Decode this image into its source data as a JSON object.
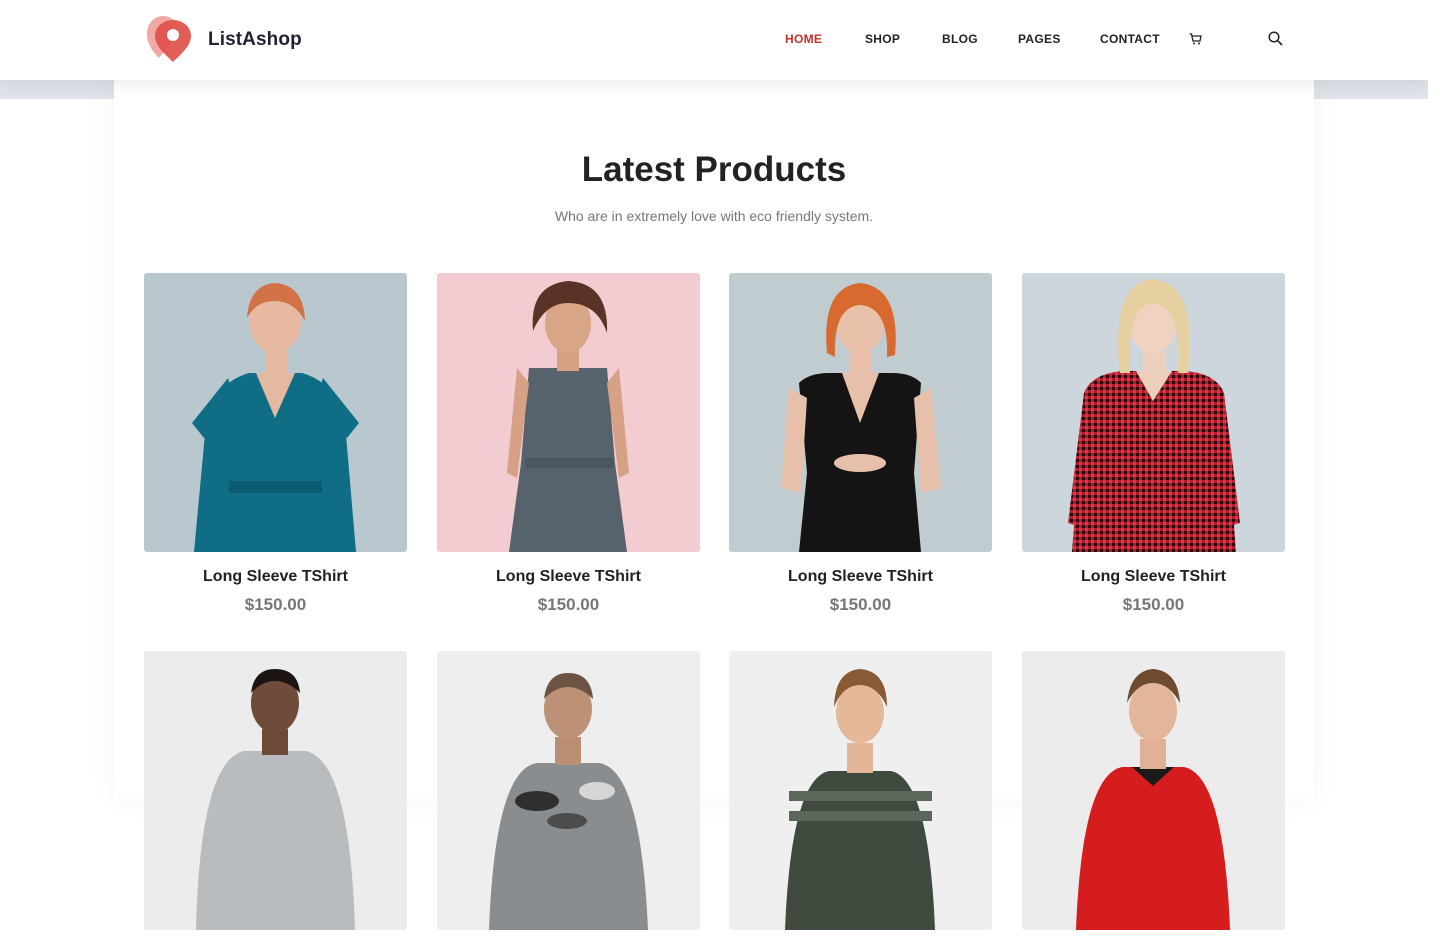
{
  "brand": {
    "name": "ListAshop"
  },
  "nav": {
    "items": [
      {
        "label": "HOME",
        "active": true
      },
      {
        "label": "SHOP",
        "active": false
      },
      {
        "label": "BLOG",
        "active": false
      },
      {
        "label": "PAGES",
        "active": false
      },
      {
        "label": "CONTACT",
        "active": false
      }
    ],
    "icons": [
      "cart-icon",
      "search-icon"
    ]
  },
  "section": {
    "title": "Latest Products",
    "subtitle": "Who are in extremely love with eco friendly system."
  },
  "products": [
    {
      "name": "Long Sleeve TShirt",
      "price": "$150.00"
    },
    {
      "name": "Long Sleeve TShirt",
      "price": "$150.00"
    },
    {
      "name": "Long Sleeve TShirt",
      "price": "$150.00"
    },
    {
      "name": "Long Sleeve TShirt",
      "price": "$150.00"
    },
    {
      "name": "",
      "price": ""
    },
    {
      "name": "",
      "price": ""
    },
    {
      "name": "",
      "price": ""
    },
    {
      "name": "",
      "price": ""
    }
  ],
  "colors": {
    "accent": "#c4302b",
    "logo": "#e0504a",
    "text_dark": "#222222",
    "text_muted": "#777777"
  }
}
